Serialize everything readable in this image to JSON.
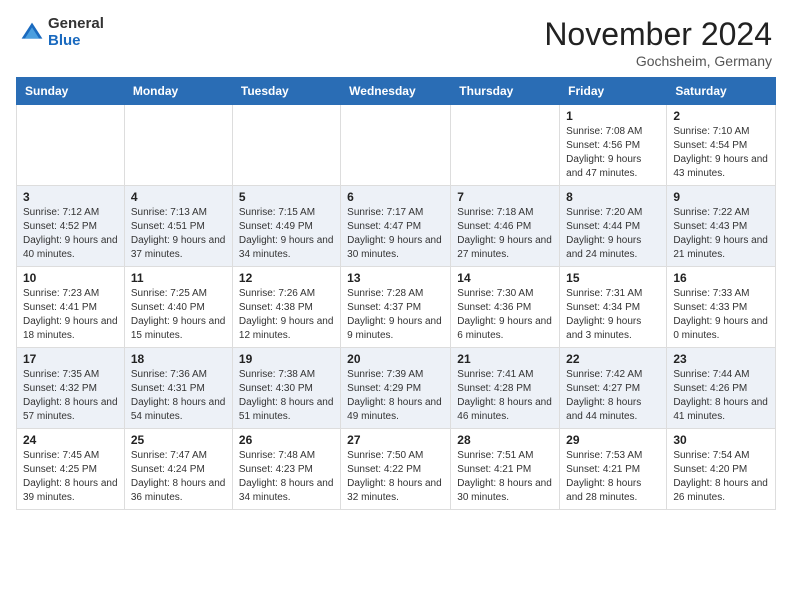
{
  "logo": {
    "general": "General",
    "blue": "Blue"
  },
  "header": {
    "title": "November 2024",
    "location": "Gochsheim, Germany"
  },
  "weekdays": [
    "Sunday",
    "Monday",
    "Tuesday",
    "Wednesday",
    "Thursday",
    "Friday",
    "Saturday"
  ],
  "weeks": [
    [
      {
        "day": "",
        "info": ""
      },
      {
        "day": "",
        "info": ""
      },
      {
        "day": "",
        "info": ""
      },
      {
        "day": "",
        "info": ""
      },
      {
        "day": "",
        "info": ""
      },
      {
        "day": "1",
        "info": "Sunrise: 7:08 AM\nSunset: 4:56 PM\nDaylight: 9 hours and 47 minutes."
      },
      {
        "day": "2",
        "info": "Sunrise: 7:10 AM\nSunset: 4:54 PM\nDaylight: 9 hours and 43 minutes."
      }
    ],
    [
      {
        "day": "3",
        "info": "Sunrise: 7:12 AM\nSunset: 4:52 PM\nDaylight: 9 hours and 40 minutes."
      },
      {
        "day": "4",
        "info": "Sunrise: 7:13 AM\nSunset: 4:51 PM\nDaylight: 9 hours and 37 minutes."
      },
      {
        "day": "5",
        "info": "Sunrise: 7:15 AM\nSunset: 4:49 PM\nDaylight: 9 hours and 34 minutes."
      },
      {
        "day": "6",
        "info": "Sunrise: 7:17 AM\nSunset: 4:47 PM\nDaylight: 9 hours and 30 minutes."
      },
      {
        "day": "7",
        "info": "Sunrise: 7:18 AM\nSunset: 4:46 PM\nDaylight: 9 hours and 27 minutes."
      },
      {
        "day": "8",
        "info": "Sunrise: 7:20 AM\nSunset: 4:44 PM\nDaylight: 9 hours and 24 minutes."
      },
      {
        "day": "9",
        "info": "Sunrise: 7:22 AM\nSunset: 4:43 PM\nDaylight: 9 hours and 21 minutes."
      }
    ],
    [
      {
        "day": "10",
        "info": "Sunrise: 7:23 AM\nSunset: 4:41 PM\nDaylight: 9 hours and 18 minutes."
      },
      {
        "day": "11",
        "info": "Sunrise: 7:25 AM\nSunset: 4:40 PM\nDaylight: 9 hours and 15 minutes."
      },
      {
        "day": "12",
        "info": "Sunrise: 7:26 AM\nSunset: 4:38 PM\nDaylight: 9 hours and 12 minutes."
      },
      {
        "day": "13",
        "info": "Sunrise: 7:28 AM\nSunset: 4:37 PM\nDaylight: 9 hours and 9 minutes."
      },
      {
        "day": "14",
        "info": "Sunrise: 7:30 AM\nSunset: 4:36 PM\nDaylight: 9 hours and 6 minutes."
      },
      {
        "day": "15",
        "info": "Sunrise: 7:31 AM\nSunset: 4:34 PM\nDaylight: 9 hours and 3 minutes."
      },
      {
        "day": "16",
        "info": "Sunrise: 7:33 AM\nSunset: 4:33 PM\nDaylight: 9 hours and 0 minutes."
      }
    ],
    [
      {
        "day": "17",
        "info": "Sunrise: 7:35 AM\nSunset: 4:32 PM\nDaylight: 8 hours and 57 minutes."
      },
      {
        "day": "18",
        "info": "Sunrise: 7:36 AM\nSunset: 4:31 PM\nDaylight: 8 hours and 54 minutes."
      },
      {
        "day": "19",
        "info": "Sunrise: 7:38 AM\nSunset: 4:30 PM\nDaylight: 8 hours and 51 minutes."
      },
      {
        "day": "20",
        "info": "Sunrise: 7:39 AM\nSunset: 4:29 PM\nDaylight: 8 hours and 49 minutes."
      },
      {
        "day": "21",
        "info": "Sunrise: 7:41 AM\nSunset: 4:28 PM\nDaylight: 8 hours and 46 minutes."
      },
      {
        "day": "22",
        "info": "Sunrise: 7:42 AM\nSunset: 4:27 PM\nDaylight: 8 hours and 44 minutes."
      },
      {
        "day": "23",
        "info": "Sunrise: 7:44 AM\nSunset: 4:26 PM\nDaylight: 8 hours and 41 minutes."
      }
    ],
    [
      {
        "day": "24",
        "info": "Sunrise: 7:45 AM\nSunset: 4:25 PM\nDaylight: 8 hours and 39 minutes."
      },
      {
        "day": "25",
        "info": "Sunrise: 7:47 AM\nSunset: 4:24 PM\nDaylight: 8 hours and 36 minutes."
      },
      {
        "day": "26",
        "info": "Sunrise: 7:48 AM\nSunset: 4:23 PM\nDaylight: 8 hours and 34 minutes."
      },
      {
        "day": "27",
        "info": "Sunrise: 7:50 AM\nSunset: 4:22 PM\nDaylight: 8 hours and 32 minutes."
      },
      {
        "day": "28",
        "info": "Sunrise: 7:51 AM\nSunset: 4:21 PM\nDaylight: 8 hours and 30 minutes."
      },
      {
        "day": "29",
        "info": "Sunrise: 7:53 AM\nSunset: 4:21 PM\nDaylight: 8 hours and 28 minutes."
      },
      {
        "day": "30",
        "info": "Sunrise: 7:54 AM\nSunset: 4:20 PM\nDaylight: 8 hours and 26 minutes."
      }
    ]
  ]
}
